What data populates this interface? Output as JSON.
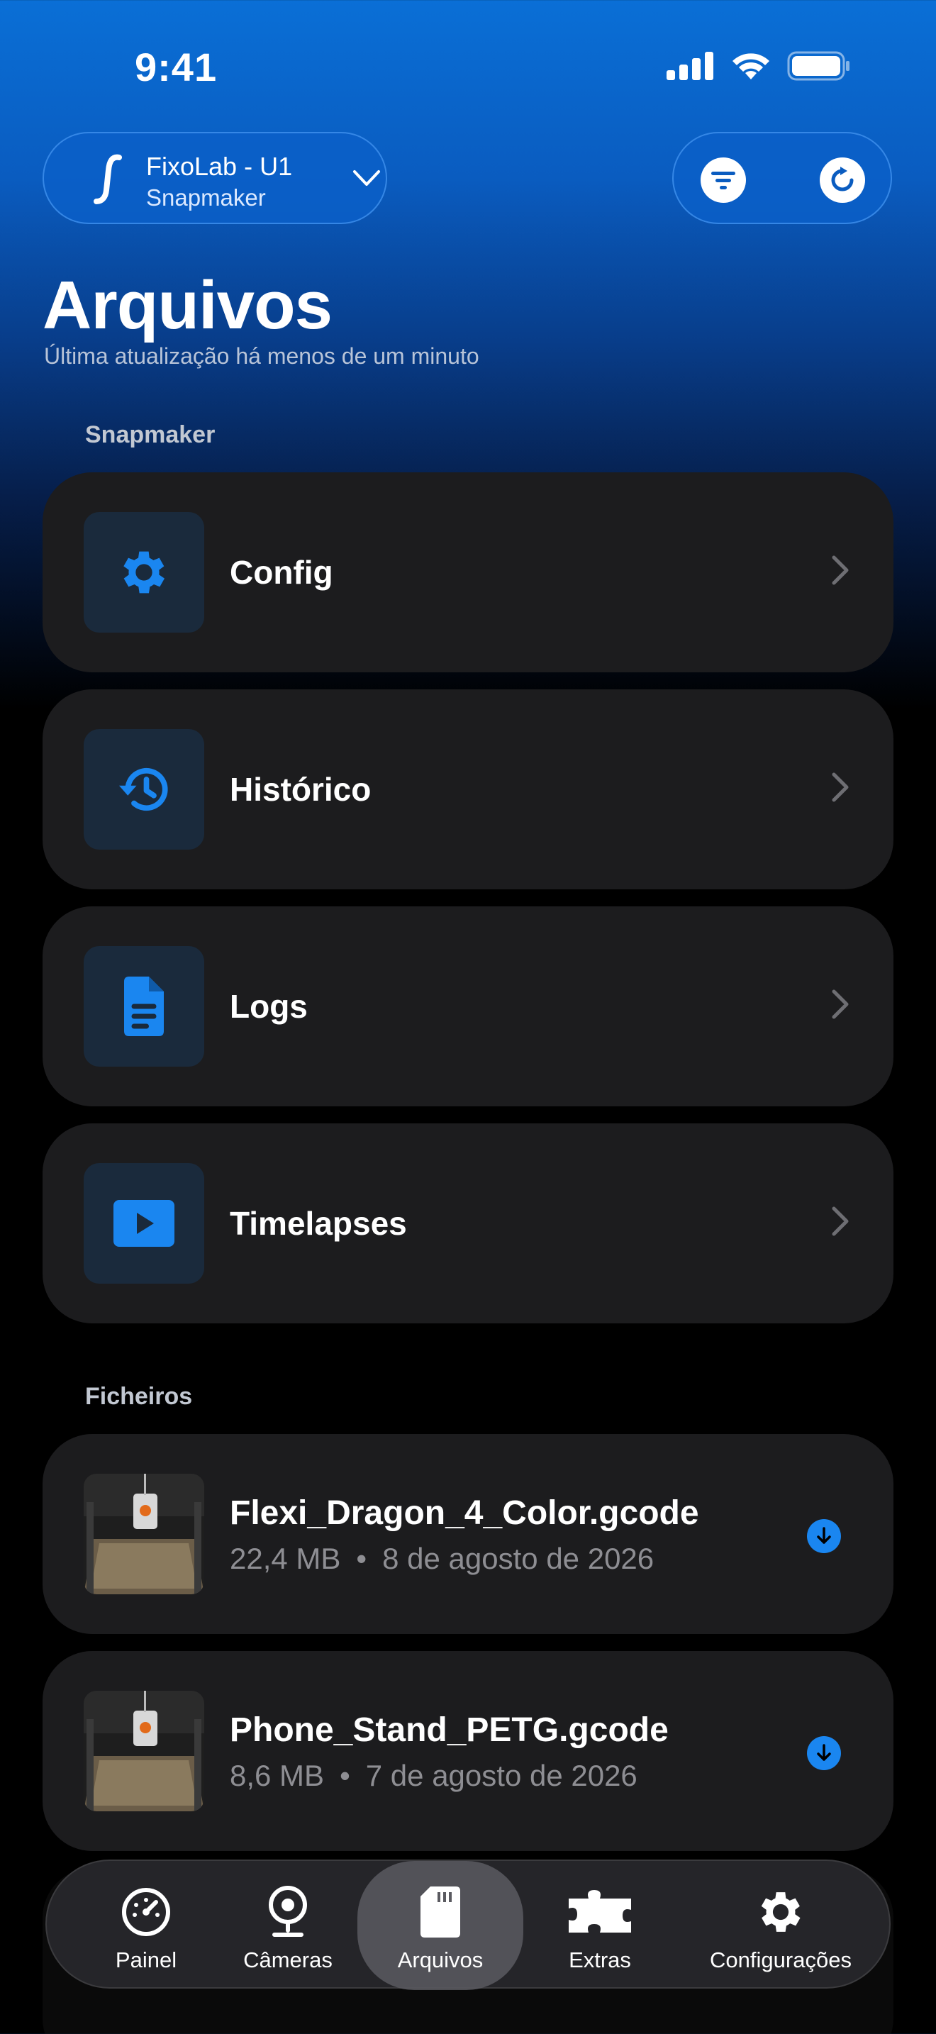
{
  "status_bar": {
    "time": "9:41"
  },
  "header": {
    "printer_name": "FixoLab - U1",
    "printer_model": "Snapmaker"
  },
  "page": {
    "title": "Arquivos",
    "subtitle": "Última atualização há menos de um minuto"
  },
  "sections": {
    "folders_label": "Snapmaker",
    "files_label": "Ficheiros"
  },
  "folders": [
    {
      "label": "Config",
      "icon": "gear-icon"
    },
    {
      "label": "Histórico",
      "icon": "history-icon"
    },
    {
      "label": "Logs",
      "icon": "document-icon"
    },
    {
      "label": "Timelapses",
      "icon": "play-icon"
    }
  ],
  "files": [
    {
      "name": "Flexi_Dragon_4_Color.gcode",
      "size": "22,4 MB",
      "date": "8 de agosto de 2026"
    },
    {
      "name": "Phone_Stand_PETG.gcode",
      "size": "8,6 MB",
      "date": "7 de agosto de 2026"
    }
  ],
  "meta_separator": "•",
  "tabs": [
    {
      "label": "Painel",
      "icon": "gauge-icon"
    },
    {
      "label": "Câmeras",
      "icon": "webcam-icon"
    },
    {
      "label": "Arquivos",
      "icon": "sd-card-icon"
    },
    {
      "label": "Extras",
      "icon": "puzzle-icon"
    },
    {
      "label": "Configurações",
      "icon": "gear-icon"
    }
  ],
  "colors": {
    "accent": "#1a86f0",
    "card_bg": "#1c1c1e",
    "icon_box_bg": "#1a2a3c"
  }
}
